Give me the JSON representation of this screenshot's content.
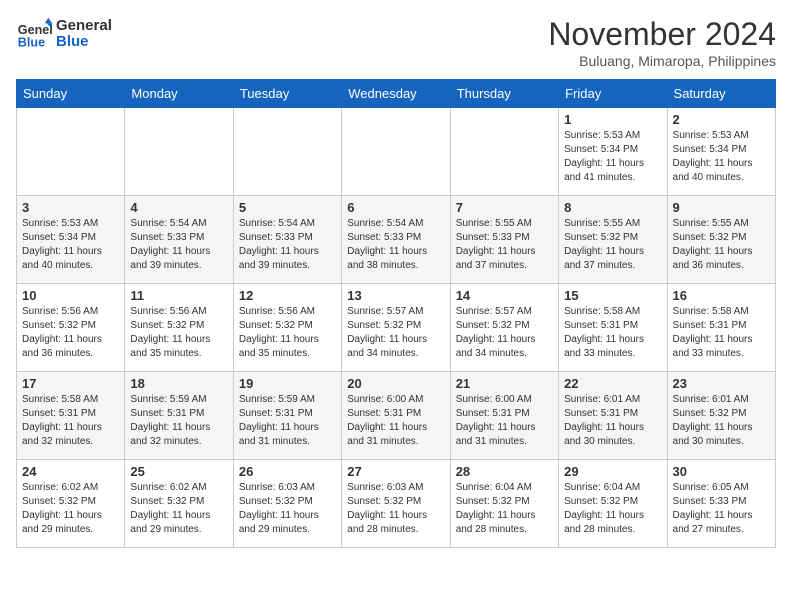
{
  "header": {
    "logo_line1": "General",
    "logo_line2": "Blue",
    "month_title": "November 2024",
    "subtitle": "Buluang, Mimaropa, Philippines"
  },
  "days_of_week": [
    "Sunday",
    "Monday",
    "Tuesday",
    "Wednesday",
    "Thursday",
    "Friday",
    "Saturday"
  ],
  "weeks": [
    [
      {
        "day": "",
        "info": ""
      },
      {
        "day": "",
        "info": ""
      },
      {
        "day": "",
        "info": ""
      },
      {
        "day": "",
        "info": ""
      },
      {
        "day": "",
        "info": ""
      },
      {
        "day": "1",
        "info": "Sunrise: 5:53 AM\nSunset: 5:34 PM\nDaylight: 11 hours\nand 41 minutes."
      },
      {
        "day": "2",
        "info": "Sunrise: 5:53 AM\nSunset: 5:34 PM\nDaylight: 11 hours\nand 40 minutes."
      }
    ],
    [
      {
        "day": "3",
        "info": "Sunrise: 5:53 AM\nSunset: 5:34 PM\nDaylight: 11 hours\nand 40 minutes."
      },
      {
        "day": "4",
        "info": "Sunrise: 5:54 AM\nSunset: 5:33 PM\nDaylight: 11 hours\nand 39 minutes."
      },
      {
        "day": "5",
        "info": "Sunrise: 5:54 AM\nSunset: 5:33 PM\nDaylight: 11 hours\nand 39 minutes."
      },
      {
        "day": "6",
        "info": "Sunrise: 5:54 AM\nSunset: 5:33 PM\nDaylight: 11 hours\nand 38 minutes."
      },
      {
        "day": "7",
        "info": "Sunrise: 5:55 AM\nSunset: 5:33 PM\nDaylight: 11 hours\nand 37 minutes."
      },
      {
        "day": "8",
        "info": "Sunrise: 5:55 AM\nSunset: 5:32 PM\nDaylight: 11 hours\nand 37 minutes."
      },
      {
        "day": "9",
        "info": "Sunrise: 5:55 AM\nSunset: 5:32 PM\nDaylight: 11 hours\nand 36 minutes."
      }
    ],
    [
      {
        "day": "10",
        "info": "Sunrise: 5:56 AM\nSunset: 5:32 PM\nDaylight: 11 hours\nand 36 minutes."
      },
      {
        "day": "11",
        "info": "Sunrise: 5:56 AM\nSunset: 5:32 PM\nDaylight: 11 hours\nand 35 minutes."
      },
      {
        "day": "12",
        "info": "Sunrise: 5:56 AM\nSunset: 5:32 PM\nDaylight: 11 hours\nand 35 minutes."
      },
      {
        "day": "13",
        "info": "Sunrise: 5:57 AM\nSunset: 5:32 PM\nDaylight: 11 hours\nand 34 minutes."
      },
      {
        "day": "14",
        "info": "Sunrise: 5:57 AM\nSunset: 5:32 PM\nDaylight: 11 hours\nand 34 minutes."
      },
      {
        "day": "15",
        "info": "Sunrise: 5:58 AM\nSunset: 5:31 PM\nDaylight: 11 hours\nand 33 minutes."
      },
      {
        "day": "16",
        "info": "Sunrise: 5:58 AM\nSunset: 5:31 PM\nDaylight: 11 hours\nand 33 minutes."
      }
    ],
    [
      {
        "day": "17",
        "info": "Sunrise: 5:58 AM\nSunset: 5:31 PM\nDaylight: 11 hours\nand 32 minutes."
      },
      {
        "day": "18",
        "info": "Sunrise: 5:59 AM\nSunset: 5:31 PM\nDaylight: 11 hours\nand 32 minutes."
      },
      {
        "day": "19",
        "info": "Sunrise: 5:59 AM\nSunset: 5:31 PM\nDaylight: 11 hours\nand 31 minutes."
      },
      {
        "day": "20",
        "info": "Sunrise: 6:00 AM\nSunset: 5:31 PM\nDaylight: 11 hours\nand 31 minutes."
      },
      {
        "day": "21",
        "info": "Sunrise: 6:00 AM\nSunset: 5:31 PM\nDaylight: 11 hours\nand 31 minutes."
      },
      {
        "day": "22",
        "info": "Sunrise: 6:01 AM\nSunset: 5:31 PM\nDaylight: 11 hours\nand 30 minutes."
      },
      {
        "day": "23",
        "info": "Sunrise: 6:01 AM\nSunset: 5:32 PM\nDaylight: 11 hours\nand 30 minutes."
      }
    ],
    [
      {
        "day": "24",
        "info": "Sunrise: 6:02 AM\nSunset: 5:32 PM\nDaylight: 11 hours\nand 29 minutes."
      },
      {
        "day": "25",
        "info": "Sunrise: 6:02 AM\nSunset: 5:32 PM\nDaylight: 11 hours\nand 29 minutes."
      },
      {
        "day": "26",
        "info": "Sunrise: 6:03 AM\nSunset: 5:32 PM\nDaylight: 11 hours\nand 29 minutes."
      },
      {
        "day": "27",
        "info": "Sunrise: 6:03 AM\nSunset: 5:32 PM\nDaylight: 11 hours\nand 28 minutes."
      },
      {
        "day": "28",
        "info": "Sunrise: 6:04 AM\nSunset: 5:32 PM\nDaylight: 11 hours\nand 28 minutes."
      },
      {
        "day": "29",
        "info": "Sunrise: 6:04 AM\nSunset: 5:32 PM\nDaylight: 11 hours\nand 28 minutes."
      },
      {
        "day": "30",
        "info": "Sunrise: 6:05 AM\nSunset: 5:33 PM\nDaylight: 11 hours\nand 27 minutes."
      }
    ]
  ]
}
